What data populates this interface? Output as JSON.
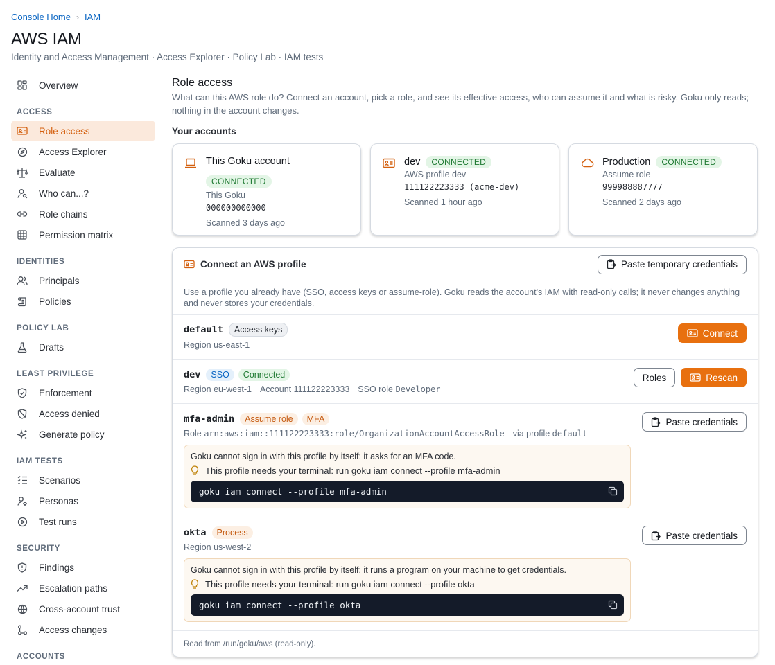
{
  "breadcrumb": {
    "home": "Console Home",
    "current": "IAM",
    "sep": "›"
  },
  "header": {
    "title": "AWS IAM",
    "subtitle": "Identity and Access Management · Access Explorer · Policy Lab · IAM tests"
  },
  "sidebar": {
    "overview": "Overview",
    "sections": {
      "access": "ACCESS",
      "identities": "IDENTITIES",
      "policy_lab": "POLICY LAB",
      "least_privilege": "LEAST PRIVILEGE",
      "iam_tests": "IAM TESTS",
      "security": "SECURITY",
      "accounts": "ACCOUNTS"
    },
    "items": {
      "role_access": "Role access",
      "access_explorer": "Access Explorer",
      "evaluate": "Evaluate",
      "who_can": "Who can...?",
      "role_chains": "Role chains",
      "permission_matrix": "Permission matrix",
      "principals": "Principals",
      "policies": "Policies",
      "drafts": "Drafts",
      "enforcement": "Enforcement",
      "access_denied": "Access denied",
      "generate_policy": "Generate policy",
      "scenarios": "Scenarios",
      "personas": "Personas",
      "test_runs": "Test runs",
      "findings": "Findings",
      "escalation_paths": "Escalation paths",
      "cross_account_trust": "Cross-account trust",
      "access_changes": "Access changes"
    }
  },
  "main": {
    "title": "Role access",
    "description": "What can this AWS role do? Connect an account, pick a role, and see its effective access, who can assume it and what is risky. Goku only reads; nothing in the account changes.",
    "accounts_title": "Your accounts",
    "accounts": [
      {
        "name": "This Goku account",
        "status": "CONNECTED",
        "line1": "This Goku",
        "id": "000000000000",
        "scanned": "Scanned 3 days ago",
        "icon": "laptop-icon"
      },
      {
        "name": "dev",
        "status": "CONNECTED",
        "line1": "AWS profile dev",
        "id": "111122223333 (acme-dev)",
        "scanned": "Scanned 1 hour ago",
        "icon": "id-card-icon"
      },
      {
        "name": "Production",
        "status": "CONNECTED",
        "line1": "Assume role",
        "id": "999988887777",
        "scanned": "Scanned 2 days ago",
        "icon": "cloud-icon"
      }
    ],
    "connect": {
      "title": "Connect an AWS profile",
      "paste_temp": "Paste temporary credentials",
      "note": "Use a profile you already have (SSO, access keys or assume-role). Goku reads the account's IAM with read-only calls; it never changes anything and never stores your credentials.",
      "footer": "Read from /run/goku/aws (read-only).",
      "profiles": {
        "default": {
          "name": "default",
          "tag": "Access keys",
          "region": "Region us-east-1",
          "connect": "Connect"
        },
        "dev": {
          "name": "dev",
          "tag_sso": "SSO",
          "tag_status": "Connected",
          "region": "Region eu-west-1",
          "account_label": "Account",
          "account": "111122223333",
          "sso_label": "SSO role",
          "sso_role": "Developer",
          "roles": "Roles",
          "rescan": "Rescan"
        },
        "mfa_admin": {
          "name": "mfa-admin",
          "tag_assume": "Assume role",
          "tag_mfa": "MFA",
          "role_label": "Role",
          "role_arn": "arn:aws:iam::111122223333:role/OrganizationAccountAccessRole",
          "via_label": "via profile",
          "via_profile": "default",
          "paste": "Paste credentials",
          "notice": "Goku cannot sign in with this profile by itself: it asks for an MFA code.",
          "hint": "This profile needs your terminal: run goku iam connect --profile mfa-admin",
          "command": "goku iam connect --profile mfa-admin"
        },
        "okta": {
          "name": "okta",
          "tag": "Process",
          "region": "Region us-west-2",
          "paste": "Paste credentials",
          "notice": "Goku cannot sign in with this profile by itself: it runs a program on your machine to get credentials.",
          "hint": "This profile needs your terminal: run goku iam connect --profile okta",
          "command": "goku iam connect --profile okta"
        }
      }
    }
  },
  "colors": {
    "accent": "#e8700f",
    "link": "#0b66c3",
    "success": "#1f7a33",
    "code_bg": "#141b29"
  }
}
